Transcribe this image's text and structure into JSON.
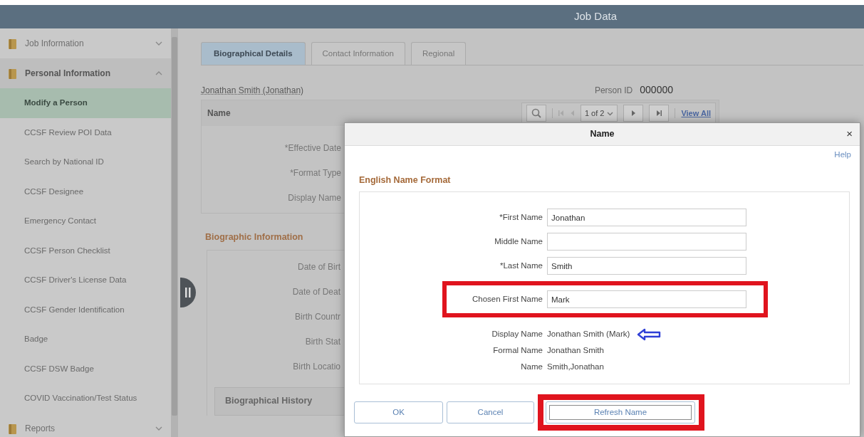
{
  "header": {
    "title": "Job Data"
  },
  "sidebar": {
    "groups": [
      {
        "label": "Job Information",
        "expanded": false
      },
      {
        "label": "Personal Information",
        "expanded": true,
        "items": [
          {
            "label": "Modify a Person",
            "selected": true
          },
          {
            "label": "CCSF Review POI Data",
            "selected": false
          },
          {
            "label": "Search by National ID",
            "selected": false
          },
          {
            "label": "CCSF Designee",
            "selected": false
          },
          {
            "label": "Emergency Contact",
            "selected": false
          },
          {
            "label": "CCSF Person Checklist",
            "selected": false
          },
          {
            "label": "CCSF Driver's License Data",
            "selected": false
          },
          {
            "label": "CCSF Gender Identification",
            "selected": false
          },
          {
            "label": "Badge",
            "selected": false
          },
          {
            "label": "CCSF DSW Badge",
            "selected": false
          },
          {
            "label": "COVID Vaccination/Test Status",
            "selected": false
          }
        ]
      },
      {
        "label": "Reports",
        "expanded": false
      }
    ]
  },
  "tabs": [
    {
      "label": "Biographical Details",
      "selected": true
    },
    {
      "label": "Contact Information",
      "selected": false
    },
    {
      "label": "Regional",
      "selected": false
    }
  ],
  "person": {
    "name_link": "Jonathan Smith (Jonathan)",
    "id_label": "Person ID",
    "id_value": "000000"
  },
  "name_section": {
    "title": "Name",
    "pager": {
      "position": "1 of 2",
      "view_all": "View All"
    },
    "labels": [
      "*Effective Date",
      "*Format Type",
      "Display Name"
    ]
  },
  "biographic": {
    "title": "Biographic Information",
    "labels": [
      "Date of Birt",
      "Date of Deat",
      "Birth Countr",
      "Birth Stat",
      "Birth Locatio"
    ],
    "history_title": "Biographical History"
  },
  "dialog": {
    "title": "Name",
    "close": "×",
    "help": "Help",
    "section": "English Name Format",
    "fields": [
      {
        "kind": "input",
        "label": "*First Name",
        "value": "Jonathan",
        "highlighted": false,
        "arrow": false
      },
      {
        "kind": "input",
        "label": "Middle Name",
        "highlighted": false,
        "arrow": false
      },
      {
        "kind": "input",
        "label": "*Last Name",
        "value": "Smith",
        "highlighted": false,
        "arrow": false
      },
      {
        "kind": "input",
        "label": "Chosen First Name",
        "value": "Mark",
        "highlighted": true,
        "arrow": false
      },
      {
        "kind": "readonly",
        "label": "Display Name",
        "value": "Jonathan Smith (Mark)",
        "highlighted": false,
        "arrow": true
      },
      {
        "kind": "readonly",
        "label": "Formal Name",
        "value": "Jonathan Smith",
        "highlighted": false,
        "arrow": false
      },
      {
        "kind": "readonly",
        "label": "Name",
        "value": "Smith,Jonathan",
        "highlighted": false,
        "arrow": false
      }
    ],
    "buttons": [
      {
        "label": "OK",
        "highlighted": false,
        "focused": false
      },
      {
        "label": "Cancel",
        "highlighted": false,
        "focused": false
      },
      {
        "label": "Refresh Name",
        "highlighted": true,
        "focused": true
      }
    ]
  }
}
